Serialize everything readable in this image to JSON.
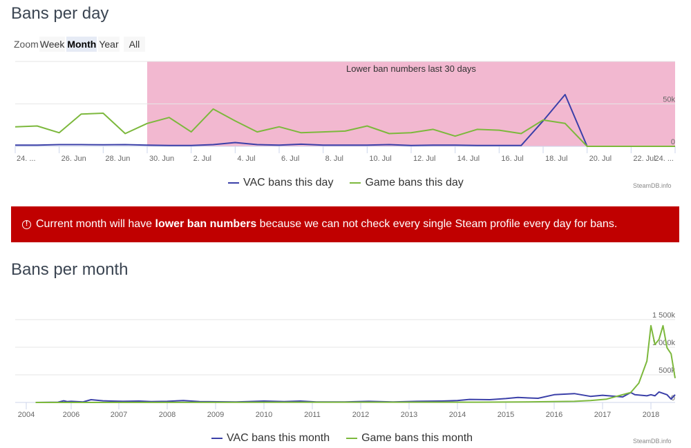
{
  "day_section": {
    "title": "Bans per day",
    "zoom": {
      "label": "Zoom",
      "buttons": [
        "Week",
        "Month",
        "Year",
        "All"
      ],
      "active": "Month"
    },
    "legend": [
      "VAC bans this day",
      "Game bans this day"
    ],
    "credit": "SteamDB.info"
  },
  "alert": {
    "icon": "exclamation-circle-icon",
    "text_before": "Current month will have ",
    "text_bold": "lower ban numbers",
    "text_after": " because we can not check every single Steam profile every day for bans.",
    "background": "#c00000"
  },
  "month_section": {
    "title": "Bans per month",
    "legend": [
      "VAC bans this month",
      "Game bans this month"
    ],
    "credit": "SteamDB.info"
  },
  "colors": {
    "vac": "#3a3fa8",
    "game": "#7cb83c",
    "band": "#f2b8d0"
  },
  "chart_data": [
    {
      "type": "line",
      "title": "Bans per day",
      "xlabel": "",
      "ylabel": "",
      "x": [
        "24 Jun",
        "25 Jun",
        "26 Jun",
        "27 Jun",
        "28 Jun",
        "29 Jun",
        "30 Jun",
        "1 Jul",
        "2 Jul",
        "3 Jul",
        "4 Jul",
        "5 Jul",
        "6 Jul",
        "7 Jul",
        "8 Jul",
        "9 Jul",
        "10 Jul",
        "11 Jul",
        "12 Jul",
        "13 Jul",
        "14 Jul",
        "15 Jul",
        "16 Jul",
        "17 Jul",
        "18 Jul",
        "19 Jul",
        "20 Jul",
        "21 Jul",
        "22 Jul",
        "23 Jul",
        "24 Jul"
      ],
      "x_tick_labels": [
        "24. ...",
        "26. Jun",
        "28. Jun",
        "30. Jun",
        "2. Jul",
        "4. Jul",
        "6. Jul",
        "8. Jul",
        "10. Jul",
        "12. Jul",
        "14. Jul",
        "16. Jul",
        "18. Jul",
        "20. Jul",
        "22. Jul",
        "24. ..."
      ],
      "y_tick_labels": [
        "0",
        "50k"
      ],
      "ylim": [
        0,
        100000
      ],
      "grid": true,
      "legend_position": "bottom",
      "plot_band": {
        "from": "30 Jun",
        "to": "24 Jul",
        "label": "Lower ban numbers last 30 days"
      },
      "series": [
        {
          "name": "VAC bans this day",
          "values": [
            1500,
            1500,
            2000,
            2000,
            1800,
            2000,
            1500,
            1000,
            1000,
            2000,
            4500,
            2000,
            1500,
            2500,
            1500,
            1500,
            1500,
            2000,
            1000,
            1500,
            1500,
            1000,
            1000,
            1000,
            30000,
            61000,
            0,
            0,
            0,
            0,
            0
          ]
        },
        {
          "name": "Game bans this day",
          "values": [
            23000,
            24000,
            16000,
            38000,
            39000,
            15000,
            27000,
            34000,
            17000,
            44000,
            30000,
            17000,
            23000,
            16000,
            17000,
            18000,
            24000,
            15000,
            16000,
            20000,
            12000,
            20000,
            19000,
            15000,
            31000,
            27000,
            0,
            0,
            0,
            0,
            0
          ]
        }
      ]
    },
    {
      "type": "line",
      "title": "Bans per month",
      "xlabel": "",
      "ylabel": "",
      "x_tick_labels": [
        "2004",
        "2006",
        "2007",
        "2008",
        "2009",
        "2010",
        "2011",
        "2012",
        "2013",
        "2014",
        "2015",
        "2016",
        "2017",
        "2018"
      ],
      "y_tick_labels": [
        "0",
        "500k",
        "1 000k",
        "1 500k"
      ],
      "ylim": [
        0,
        1500000
      ],
      "grid": true,
      "legend_position": "bottom",
      "series": [
        {
          "name": "VAC bans this month",
          "points": [
            [
              "2004-06",
              0
            ],
            [
              "2005-06",
              5000
            ],
            [
              "2005-09",
              30000
            ],
            [
              "2005-11",
              15000
            ],
            [
              "2006-01",
              20000
            ],
            [
              "2006-04",
              10000
            ],
            [
              "2006-06",
              50000
            ],
            [
              "2006-09",
              30000
            ],
            [
              "2006-11",
              25000
            ],
            [
              "2007-02",
              20000
            ],
            [
              "2007-06",
              25000
            ],
            [
              "2007-09",
              15000
            ],
            [
              "2008-01",
              20000
            ],
            [
              "2008-05",
              35000
            ],
            [
              "2008-09",
              15000
            ],
            [
              "2009-06",
              10000
            ],
            [
              "2009-09",
              15000
            ],
            [
              "2010-01",
              25000
            ],
            [
              "2010-06",
              15000
            ],
            [
              "2010-10",
              25000
            ],
            [
              "2011-02",
              10000
            ],
            [
              "2011-09",
              10000
            ],
            [
              "2012-03",
              20000
            ],
            [
              "2012-09",
              10000
            ],
            [
              "2013-03",
              20000
            ],
            [
              "2013-09",
              25000
            ],
            [
              "2014-01",
              35000
            ],
            [
              "2014-04",
              55000
            ],
            [
              "2014-09",
              50000
            ],
            [
              "2015-01",
              70000
            ],
            [
              "2015-04",
              90000
            ],
            [
              "2015-09",
              75000
            ],
            [
              "2016-01",
              140000
            ],
            [
              "2016-06",
              160000
            ],
            [
              "2016-10",
              110000
            ],
            [
              "2017-01",
              130000
            ],
            [
              "2017-06",
              100000
            ],
            [
              "2017-08",
              180000
            ],
            [
              "2017-09",
              140000
            ],
            [
              "2017-12",
              120000
            ],
            [
              "2018-01",
              140000
            ],
            [
              "2018-02",
              120000
            ],
            [
              "2018-03",
              190000
            ],
            [
              "2018-05",
              140000
            ],
            [
              "2018-06",
              60000
            ],
            [
              "2018-07",
              140000
            ]
          ]
        },
        {
          "name": "Game bans this month",
          "points": [
            [
              "2004-06",
              0
            ],
            [
              "2013-06",
              5000
            ],
            [
              "2014-06",
              5000
            ],
            [
              "2015-06",
              10000
            ],
            [
              "2016-06",
              20000
            ],
            [
              "2016-10",
              35000
            ],
            [
              "2017-02",
              60000
            ],
            [
              "2017-05",
              120000
            ],
            [
              "2017-08",
              180000
            ],
            [
              "2017-10",
              350000
            ],
            [
              "2017-12",
              750000
            ],
            [
              "2018-01",
              1390000
            ],
            [
              "2018-02",
              1050000
            ],
            [
              "2018-03",
              1140000
            ],
            [
              "2018-04",
              1390000
            ],
            [
              "2018-05",
              990000
            ],
            [
              "2018-06",
              880000
            ],
            [
              "2018-07",
              440000
            ]
          ]
        }
      ]
    }
  ]
}
